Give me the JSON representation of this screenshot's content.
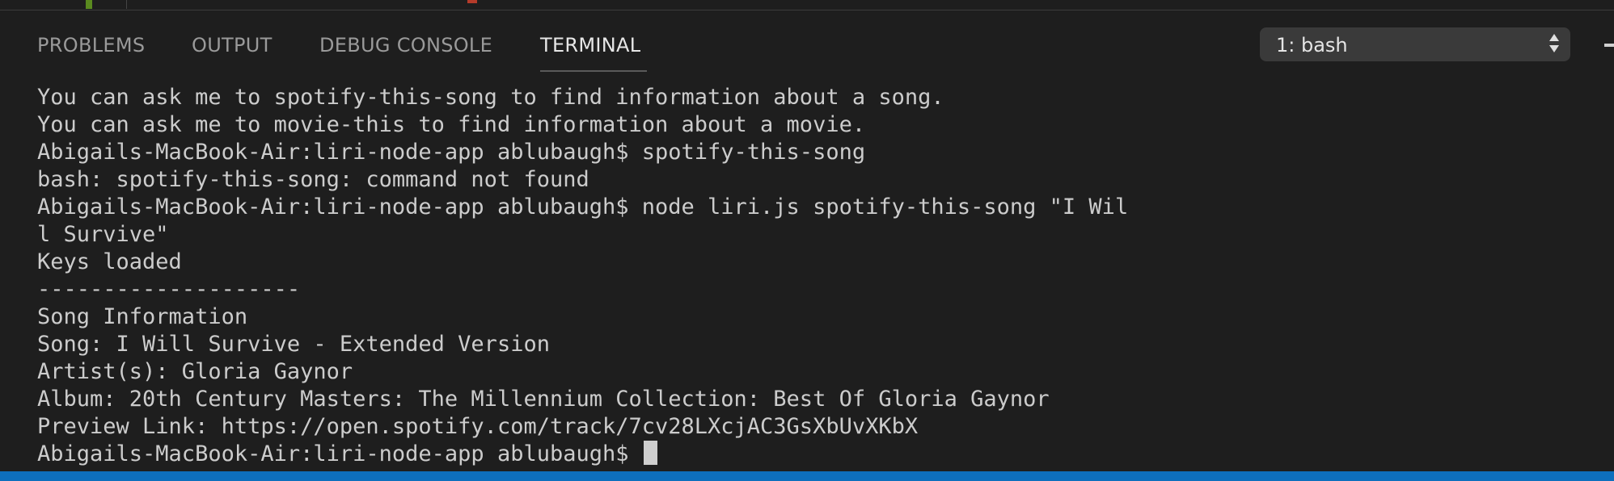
{
  "tabs": [
    {
      "label": "PROBLEMS"
    },
    {
      "label": "OUTPUT"
    },
    {
      "label": "DEBUG CONSOLE"
    },
    {
      "label": "TERMINAL"
    }
  ],
  "active_tab": "TERMINAL",
  "terminal_select": {
    "value": "1: bash"
  },
  "terminal": {
    "lines": [
      "You can ask me to spotify-this-song to find information about a song.",
      "You can ask me to movie-this to find information about a movie.",
      "Abigails-MacBook-Air:liri-node-app ablubaugh$ spotify-this-song",
      "bash: spotify-this-song: command not found",
      "Abigails-MacBook-Air:liri-node-app ablubaugh$ node liri.js spotify-this-song \"I Wil",
      "l Survive\"",
      "Keys loaded",
      "--------------------",
      "Song Information",
      "Song: I Will Survive - Extended Version",
      "Artist(s): Gloria Gaynor",
      "Album: 20th Century Masters: The Millennium Collection: Best Of Gloria Gaynor",
      "Preview Link: https://open.spotify.com/track/7cv28LXcjAC3GsXbUvXKbX"
    ],
    "prompt": "Abigails-MacBook-Air:liri-node-app ablubaugh$ "
  },
  "colors": {
    "background": "#1e1e1e",
    "text": "#cccccc",
    "status_bar": "#0e6fbd",
    "tab_active": "#e7e7e7",
    "tab_inactive": "#9a9a9a"
  }
}
